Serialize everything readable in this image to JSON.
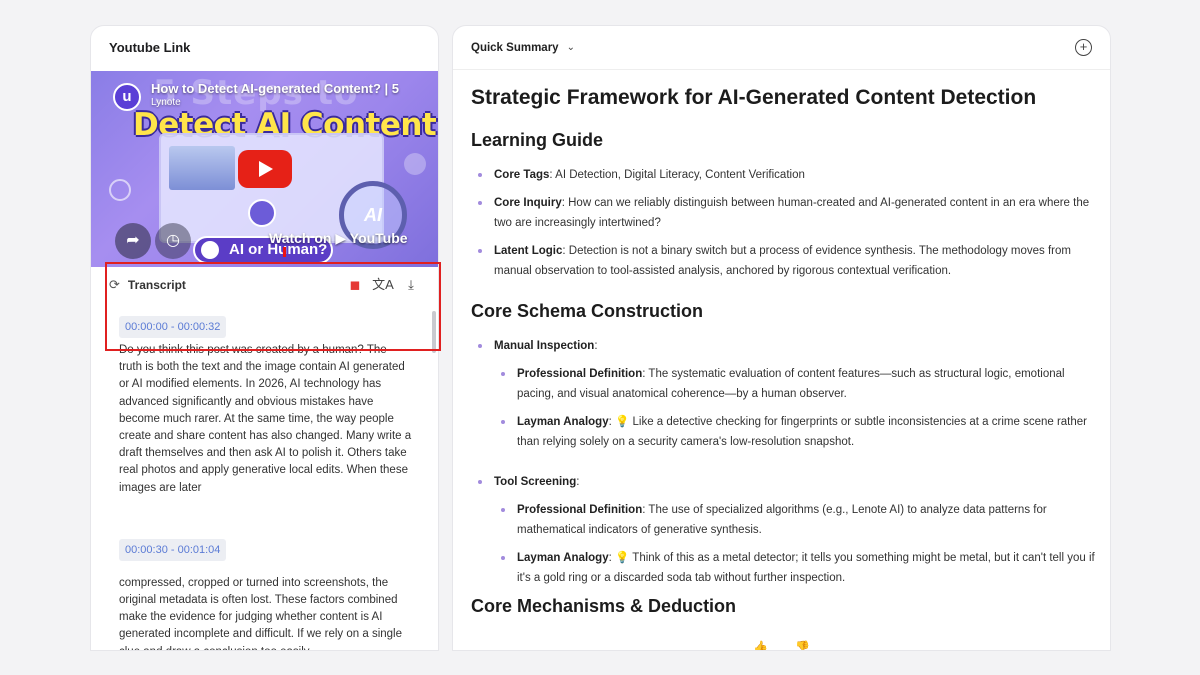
{
  "left": {
    "header": "Youtube Link",
    "video": {
      "title": "How to Detect AI-generated Content? | 5",
      "channel": "Lynote",
      "bg_word": "5 Steps to",
      "headline": "Detect AI Content",
      "logo_letter": "u",
      "badge_text": "AI",
      "pill_text": "AI or Human?",
      "watch_text": "Watch on ▶ YouTube"
    },
    "transcript": {
      "label": "Transcript",
      "segments": [
        {
          "time": "00:00:00 - 00:00:32",
          "text": "Do you think this post was created by a human? The truth is both the text and the image contain AI generated or AI modified elements. In 2026, AI technology has advanced significantly and obvious mistakes have become much rarer. At the same time, the way people create and share content has also changed. Many write a draft themselves and then ask AI to polish it. Others take real photos and apply generative local edits. When these images are later"
        },
        {
          "time": "00:00:30 - 00:01:04",
          "text": "compressed, cropped or turned into screenshots, the original metadata is often lost. These factors combined make the evidence for judging whether content is AI generated incomplete and difficult. If we rely on a single clue and draw a conclusion too easily,"
        }
      ]
    }
  },
  "right": {
    "header": "Quick Summary",
    "title": "Strategic Framework for AI-Generated Content Detection",
    "learning_guide": {
      "heading": "Learning Guide",
      "items": [
        {
          "label": "Core Tags",
          "text": ": AI Detection, Digital Literacy, Content Verification"
        },
        {
          "label": "Core Inquiry",
          "text": ": How can we reliably distinguish between human-created and AI-generated content in an era where the two are increasingly intertwined?"
        },
        {
          "label": "Latent Logic",
          "text": ": Detection is not a binary switch but a process of evidence synthesis. The methodology moves from manual observation to tool-assisted analysis, anchored by rigorous contextual verification."
        }
      ]
    },
    "schema": {
      "heading": "Core Schema Construction",
      "manual": {
        "label": "Manual Inspection",
        "def_label": "Professional Definition",
        "def_text": ": The systematic evaluation of content features—such as structural logic, emotional pacing, and visual anatomical coherence—by a human observer.",
        "analogy_label": "Layman Analogy",
        "analogy_text": ": 💡 Like a detective checking for fingerprints or subtle inconsistencies at a crime scene rather than relying solely on a security camera's low-resolution snapshot."
      },
      "tool": {
        "label": "Tool Screening",
        "def_label": "Professional Definition",
        "def_text": ": The use of specialized algorithms (e.g., Lenote AI) to analyze data patterns for mathematical indicators of generative synthesis.",
        "analogy_label": "Layman Analogy",
        "analogy_text": ": 💡 Think of this as a metal detector; it tells you something might be metal, but it can't tell you if it's a gold ring or a discarded soda tab without further inspection."
      }
    },
    "mechanisms_heading": "Core Mechanisms & Deduction"
  }
}
